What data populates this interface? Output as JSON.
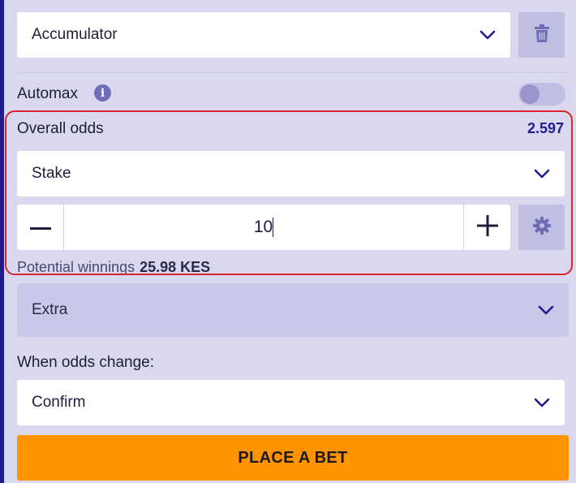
{
  "bet_type": {
    "selected": "Accumulator",
    "icon": "chevron-down-icon"
  },
  "delete_button": {
    "icon": "trash-icon"
  },
  "automax": {
    "label": "Automax",
    "info_icon": "info-icon",
    "toggle_on": false
  },
  "overall_odds": {
    "label": "Overall odds",
    "value": "2.597"
  },
  "stake_mode": {
    "selected": "Stake"
  },
  "stake": {
    "value": "10",
    "decrement_icon": "minus-icon",
    "increment_icon": "plus-icon",
    "settings_icon": "gear-icon"
  },
  "potential_winnings": {
    "label": "Potential winnings",
    "value": "25.98 KES"
  },
  "extra": {
    "label": "Extra"
  },
  "odds_change": {
    "label": "When odds change:",
    "selected": "Confirm"
  },
  "place_bet": {
    "label": "PLACE A BET"
  },
  "colors": {
    "accent": "#1f1d8e",
    "button": "#ff9300",
    "highlight": "#d8242d",
    "background": "#d9d8ef"
  }
}
